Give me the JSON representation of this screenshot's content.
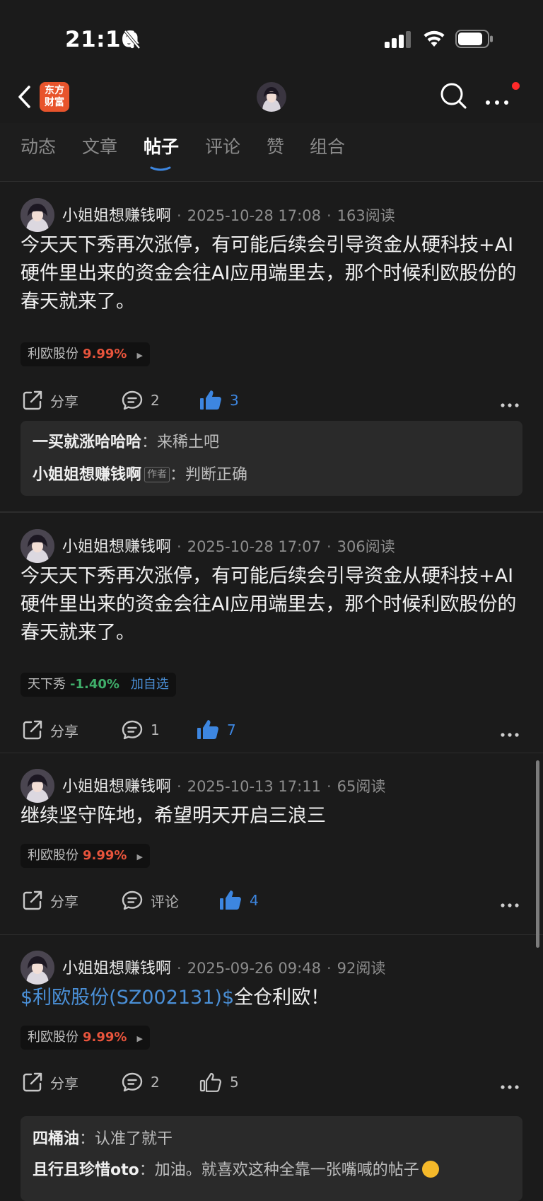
{
  "status": {
    "time": "21:16"
  },
  "tabs": [
    {
      "label": "动态",
      "active": false
    },
    {
      "label": "文章",
      "active": false
    },
    {
      "label": "帖子",
      "active": true
    },
    {
      "label": "评论",
      "active": false
    },
    {
      "label": "赞",
      "active": false
    },
    {
      "label": "组合",
      "active": false
    }
  ],
  "app": {
    "logo_line1": "东方",
    "logo_line2": "财富"
  },
  "posts": [
    {
      "author": "小姐姐想赚钱啊",
      "datetime": "2025-10-28 17:08",
      "reads": "163阅读",
      "content": "今天天下秀再次涨停，有可能后续会引导资金从硬科技+AI硬件里出来的资金会往AI应用端里去，那个时候利欧股份的春天就来了。",
      "stock": {
        "name": "利欧股份",
        "change": "9.99%"
      },
      "share": "分享",
      "comments": "2",
      "likes": "3",
      "replies": [
        {
          "name": "一买就涨哈哈哈",
          "text": "来稀土吧"
        },
        {
          "name": "小姐姐想赚钱啊",
          "tag": "作者",
          "text": "判断正确"
        }
      ]
    },
    {
      "author": "小姐姐想赚钱啊",
      "datetime": "2025-10-28 17:07",
      "reads": "306阅读",
      "content": "今天天下秀再次涨停，有可能后续会引导资金从硬科技+AI硬件里出来的资金会往AI应用端里去，那个时候利欧股份的春天就来了。",
      "stock": {
        "name": "天下秀",
        "change": "-1.40%",
        "watch": "加自选"
      },
      "share": "分享",
      "comments": "1",
      "likes": "7"
    },
    {
      "author": "小姐姐想赚钱啊",
      "datetime": "2025-10-13 17:11",
      "reads": "65阅读",
      "content": "继续坚守阵地，希望明天开启三浪三",
      "stock": {
        "name": "利欧股份",
        "change": "9.99%"
      },
      "share": "分享",
      "comments": "评论",
      "likes": "4"
    },
    {
      "author": "小姐姐想赚钱啊",
      "datetime": "2025-09-26 09:48",
      "reads": "92阅读",
      "content_link": "$利欧股份(SZ002131)$",
      "content_rest": "全仓利欧！",
      "stock": {
        "name": "利欧股份",
        "change": "9.99%"
      },
      "share": "分享",
      "comments": "2",
      "likes": "5",
      "replies": [
        {
          "name": "四桶油",
          "text": "认准了就干"
        },
        {
          "name": "且行且珍惜oto",
          "text": "加油。就喜欢这种全靠一张嘴喊的帖子"
        }
      ]
    }
  ],
  "colors": {
    "up": "#e8543c",
    "down": "#3fae6a",
    "accent": "#3d86e0",
    "brand": "#e8542c"
  }
}
